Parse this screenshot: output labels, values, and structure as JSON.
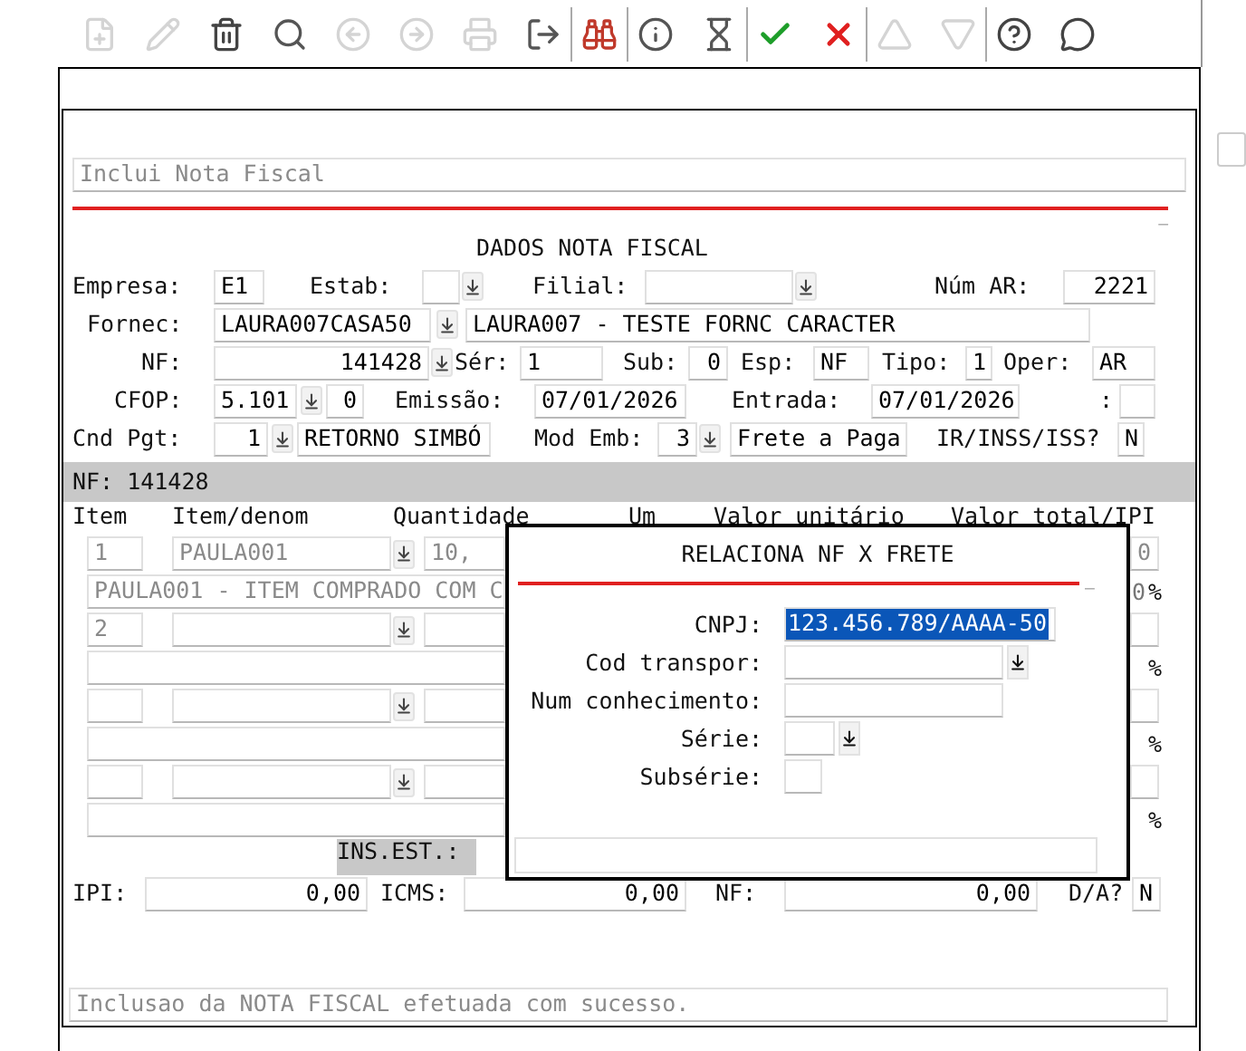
{
  "toolbar": {
    "groups": [
      [
        {
          "kind": "new",
          "disabled": true
        },
        {
          "kind": "edit",
          "disabled": true
        },
        {
          "kind": "delete",
          "disabled": false
        },
        {
          "kind": "search",
          "disabled": false
        },
        {
          "kind": "previous",
          "disabled": true
        },
        {
          "kind": "next",
          "disabled": true
        },
        {
          "kind": "print",
          "disabled": true
        },
        {
          "kind": "exit",
          "disabled": false
        }
      ],
      [
        {
          "kind": "find",
          "disabled": false
        }
      ],
      [
        {
          "kind": "info",
          "disabled": false
        },
        {
          "kind": "wait",
          "disabled": false
        }
      ],
      [
        {
          "kind": "confirm",
          "disabled": false
        },
        {
          "kind": "cancel",
          "disabled": false
        }
      ],
      [
        {
          "kind": "up",
          "disabled": true
        },
        {
          "kind": "down",
          "disabled": true
        }
      ],
      [
        {
          "kind": "help",
          "disabled": false
        },
        {
          "kind": "comment",
          "disabled": false
        }
      ]
    ]
  },
  "form_title": "Inclui Nota Fiscal",
  "minimize": "_",
  "section_title": "DADOS NOTA FISCAL",
  "fields": {
    "empresa": {
      "label": "Empresa:",
      "value": "E1"
    },
    "estab": {
      "label": "Estab:"
    },
    "filial": {
      "label": "Filial:"
    },
    "num_ar": {
      "label": "Núm AR:",
      "value": "2221"
    },
    "fornec": {
      "label": "Fornec:",
      "value": "LAURA007CASA50",
      "description": "LAURA007 - TESTE FORNC CARACTER"
    },
    "nf": {
      "label": "NF:",
      "value": "141428"
    },
    "serie": {
      "label": "Sér:",
      "value": "1"
    },
    "sub": {
      "label": "Sub:",
      "value": "0"
    },
    "esp": {
      "label": "Esp:",
      "value": "NF"
    },
    "tipo": {
      "label": "Tipo:",
      "value": "1"
    },
    "oper": {
      "label": "Oper:",
      "value": "AR"
    },
    "cfop": {
      "label": "CFOP:",
      "value": "5.101",
      "extra": "0"
    },
    "emissao": {
      "label": "Emissão:",
      "value": "07/01/2026"
    },
    "entrada": {
      "label": "Entrada:",
      "value": "07/01/2026"
    },
    "colon": {
      "label": ":"
    },
    "cnd_pgt": {
      "label": "Cnd Pgt:",
      "value": "1",
      "description": "RETORNO SIMBÓ"
    },
    "mod_emb": {
      "label": "Mod Emb:",
      "value": "3",
      "description": "Frete a Paga"
    },
    "ir_inss": {
      "label": "IR/INSS/ISS?",
      "value": "N"
    }
  },
  "nf_bar": "NF: 141428",
  "items": {
    "columns": [
      "Item",
      "Item/denom",
      "Quantidade",
      "Um",
      "Valor unitário",
      "Valor total/IPI"
    ],
    "rows": [
      {
        "item": "1",
        "code": "PAULA001",
        "quantity": "10,",
        "total": "0",
        "description": "PAULA001 - ITEM COMPRADO COM C",
        "ipi": "0",
        "percent": "%"
      },
      {
        "item": "2",
        "percent": "%"
      },
      {
        "percent": "%"
      },
      {
        "percent": "%"
      }
    ]
  },
  "ins_est": "INS.EST.:",
  "totals": [
    {
      "label": "IPI:",
      "value": "0,00"
    },
    {
      "label": "ICMS:",
      "value": "0,00"
    },
    {
      "label": "NF:",
      "value": "0,00"
    }
  ],
  "da": {
    "label": "D/A?",
    "value": "N"
  },
  "message": "Inclusao da NOTA FISCAL efetuada com sucesso.",
  "dialog": {
    "title": "RELACIONA NF X FRETE",
    "minimize": "_",
    "fields": [
      {
        "kind": "text",
        "label": "CNPJ:",
        "value": "123.456.789/AAAA-50",
        "selected": true
      },
      {
        "kind": "lookup",
        "label": "Cod transpor:"
      },
      {
        "kind": "text",
        "label": "Num conhecimento:"
      },
      {
        "kind": "lookup",
        "label": "Série:"
      },
      {
        "kind": "text",
        "label": "Subsérie:"
      }
    ]
  }
}
